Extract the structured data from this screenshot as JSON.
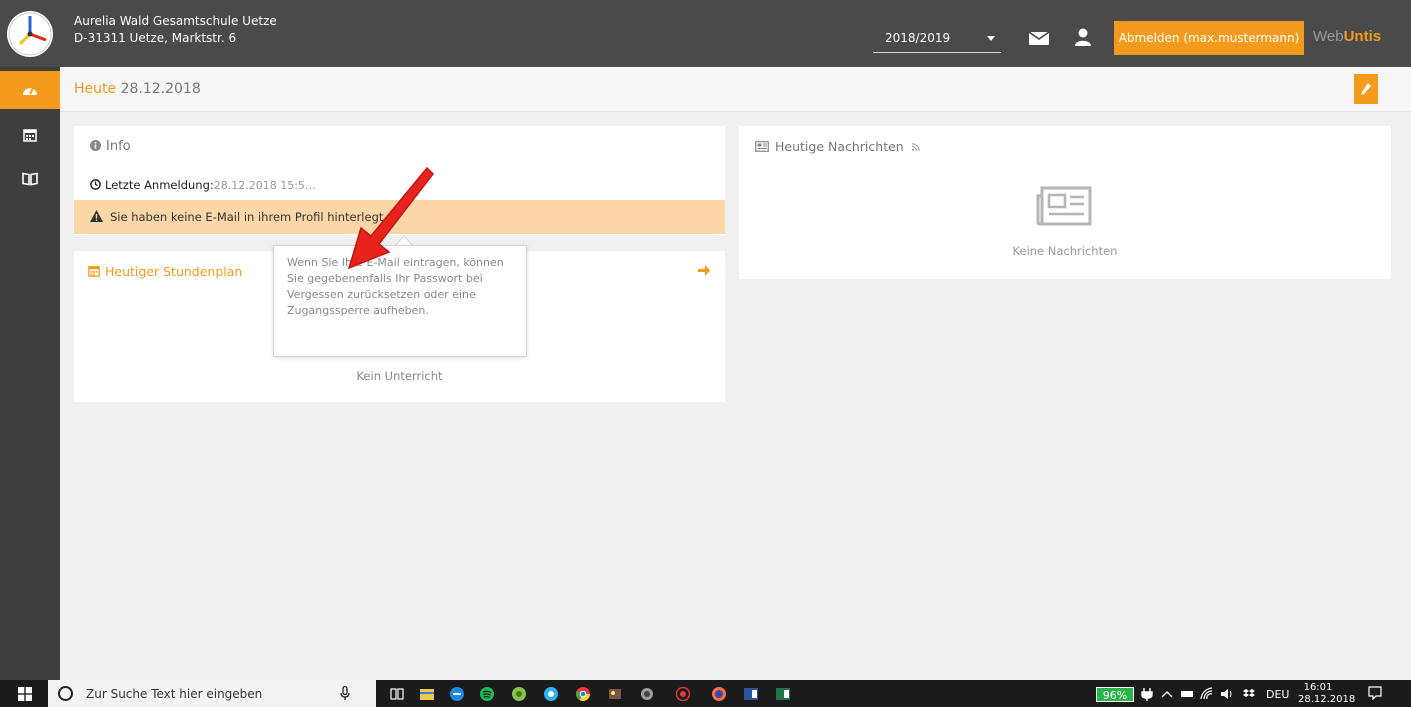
{
  "header": {
    "school_name": "Aurelia Wald Gesamtschule Uetze",
    "school_address": "D-31311 Uetze, Marktstr. 6",
    "school_year": "2018/2019",
    "logout_label": "Abmelden (max.mustermann)",
    "brand_web": "Web",
    "brand_untis": "Untis"
  },
  "subheader": {
    "today_label": "Heute",
    "date": "28.12.2018"
  },
  "info": {
    "title": "Info",
    "last_login_label": "Letzte Anmeldung:",
    "last_login_value": "28.12.2018 15:5…",
    "warning": "Sie haben keine E-Mail in ihrem Profil hinterlegt.",
    "tooltip": "Wenn Sie Ihre E-Mail eintragen, können Sie gegebenenfalls Ihr Passwort bei Vergessen zurücksetzen oder eine Zugangssperre aufheben."
  },
  "timetable": {
    "title": "Heutiger Stundenplan",
    "empty": "Kein Unterricht"
  },
  "news": {
    "title": "Heutige Nachrichten",
    "empty": "Keine Nachrichten"
  },
  "taskbar": {
    "search_placeholder": "Zur Suche Text hier eingeben",
    "battery": "96%",
    "language": "DEU",
    "time": "16:01",
    "date": "28.12.2018"
  },
  "colors": {
    "accent": "#f49b1e",
    "header_bg": "#4a4a4a",
    "nav_bg": "#3e3e3e",
    "warning_bg": "#fbd7a7",
    "annotation_arrow": "#e8231b"
  }
}
